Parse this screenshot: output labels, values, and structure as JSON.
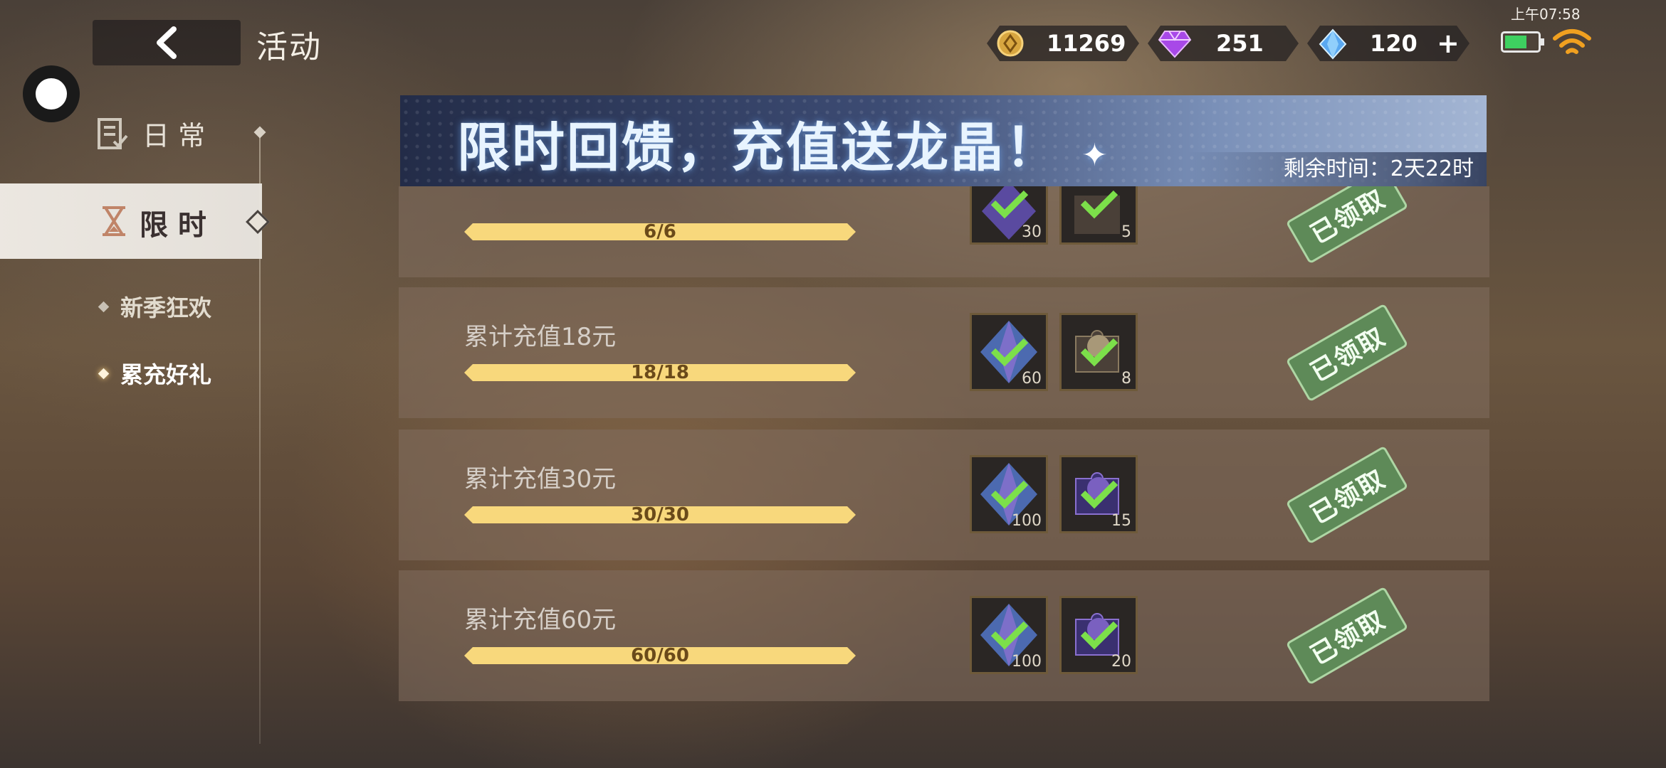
{
  "status_bar": {
    "time": "上午07:58"
  },
  "header": {
    "title": "活动"
  },
  "currencies": [
    {
      "name": "gold-coin",
      "value": "11269"
    },
    {
      "name": "purple-diamond",
      "value": "251"
    },
    {
      "name": "blue-crystal",
      "value": "120",
      "add_label": "+"
    }
  ],
  "sidebar": {
    "daily_label": "日 常",
    "limited_label": "限 时",
    "sub_items": [
      {
        "label": "新季狂欢",
        "active": false
      },
      {
        "label": "累充好礼",
        "active": true
      }
    ]
  },
  "banner": {
    "title": "限时回馈，充值送龙晶！",
    "sparkle": "✦",
    "remaining_time": "剩余时间：2天22时"
  },
  "rewards": [
    {
      "title": "",
      "progress": "6/6",
      "items": [
        {
          "icon": "crystal-icon",
          "count": "30"
        },
        {
          "icon": "puzzle-fragment-icon",
          "count": "5"
        }
      ],
      "status": "已领取"
    },
    {
      "title": "累计充值18元",
      "progress": "18/18",
      "items": [
        {
          "icon": "crystal-icon",
          "count": "60"
        },
        {
          "icon": "puzzle-fragment-icon",
          "count": "8"
        }
      ],
      "status": "已领取"
    },
    {
      "title": "累计充值30元",
      "progress": "30/30",
      "items": [
        {
          "icon": "crystal-icon",
          "count": "100"
        },
        {
          "icon": "puzzle-fragment-icon",
          "count": "15"
        }
      ],
      "status": "已领取"
    },
    {
      "title": "累计充值60元",
      "progress": "60/60",
      "items": [
        {
          "icon": "crystal-icon",
          "count": "100"
        },
        {
          "icon": "puzzle-fragment-icon",
          "count": "20"
        }
      ],
      "status": "已领取"
    }
  ],
  "colors": {
    "progress_fill": "#f8d87c",
    "claimed_stamp": "#5e8a58",
    "highlight": "#f0c878"
  }
}
